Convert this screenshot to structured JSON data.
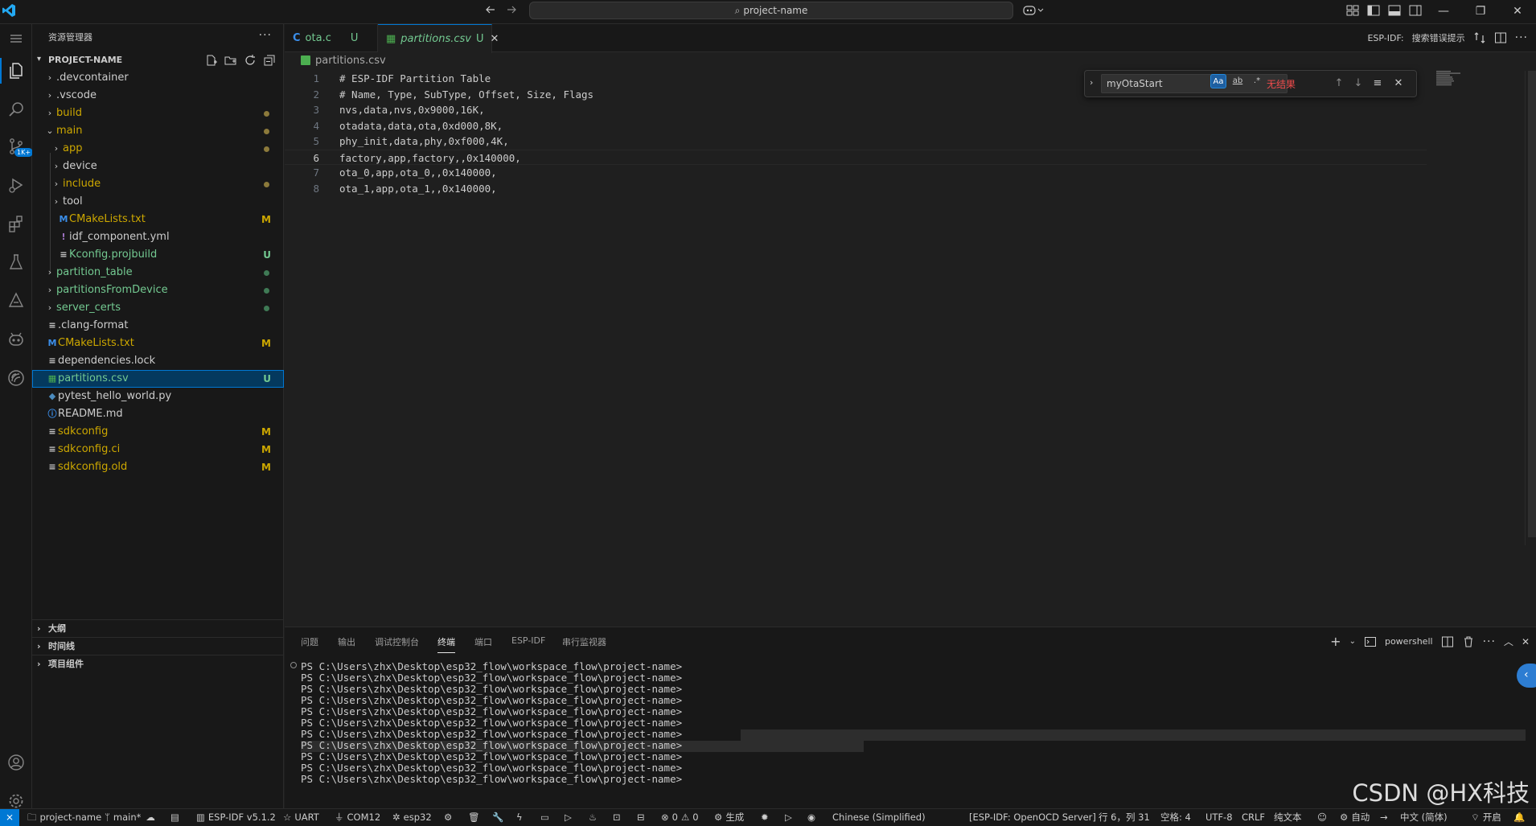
{
  "titlebar": {
    "search_text": "project-name",
    "back_icon": "arrow-left-icon",
    "forward_icon": "arrow-right-icon"
  },
  "sidebar": {
    "title": "资源管理器",
    "more": "···",
    "project": "PROJECT-NAME",
    "items": [
      {
        "label": "devcontainer",
        "display": ".devcontainer",
        "kind": "folder",
        "depth": 0,
        "color": "#cccccc",
        "deco": ""
      },
      {
        "label": "vscode",
        "display": ".vscode",
        "kind": "folder",
        "depth": 0,
        "color": "#cccccc",
        "deco": ""
      },
      {
        "label": "build",
        "display": "build",
        "kind": "folder",
        "depth": 0,
        "color": "#cca700",
        "deco": "dot",
        "deco_color": "#8c7a3b"
      },
      {
        "label": "main",
        "display": "main",
        "kind": "folder-open",
        "depth": 0,
        "color": "#cca700",
        "deco": "dot",
        "deco_color": "#8c7a3b"
      },
      {
        "label": "app",
        "display": "app",
        "kind": "folder",
        "depth": 1,
        "color": "#cca700",
        "deco": "dot",
        "deco_color": "#8c7a3b"
      },
      {
        "label": "device",
        "display": "device",
        "kind": "folder",
        "depth": 1,
        "color": "#cccccc",
        "deco": ""
      },
      {
        "label": "include",
        "display": "include",
        "kind": "folder",
        "depth": 1,
        "color": "#cca700",
        "deco": "dot",
        "deco_color": "#8c7a3b"
      },
      {
        "label": "tool",
        "display": "tool",
        "kind": "folder",
        "depth": 1,
        "color": "#cccccc",
        "deco": ""
      },
      {
        "label": "CMakeLists.txt",
        "display": "CMakeLists.txt",
        "kind": "file",
        "icon": "M",
        "icon_color": "#3b8eea",
        "depth": 1,
        "color": "#cca700",
        "deco": "M",
        "deco_color": "#cca700"
      },
      {
        "label": "idf_component.yml",
        "display": "idf_component.yml",
        "kind": "file",
        "icon": "!",
        "icon_color": "#a074c4",
        "depth": 1,
        "color": "#cccccc",
        "deco": ""
      },
      {
        "label": "Kconfig.projbuild",
        "display": "Kconfig.projbuild",
        "kind": "file",
        "icon": "≡",
        "icon_color": "#cccccc",
        "depth": 1,
        "color": "#73c991",
        "deco": "U",
        "deco_color": "#73c991"
      },
      {
        "label": "partition_table",
        "display": "partition_table",
        "kind": "folder",
        "depth": 0,
        "color": "#73c991",
        "deco": "dot",
        "deco_color": "#3f7a55"
      },
      {
        "label": "partitionsFromDevice",
        "display": "partitionsFromDevice",
        "kind": "folder",
        "depth": 0,
        "color": "#73c991",
        "deco": "dot",
        "deco_color": "#3f7a55"
      },
      {
        "label": "server_certs",
        "display": "server_certs",
        "kind": "folder",
        "depth": 0,
        "color": "#73c991",
        "deco": "dot",
        "deco_color": "#3f7a55"
      },
      {
        "label": "clang-format",
        "display": ".clang-format",
        "kind": "file",
        "icon": "≡",
        "icon_color": "#cccccc",
        "depth": 0,
        "color": "#cccccc",
        "deco": ""
      },
      {
        "label": "CMakeLists.txt",
        "display": "CMakeLists.txt",
        "kind": "file",
        "icon": "M",
        "icon_color": "#3b8eea",
        "depth": 0,
        "color": "#cca700",
        "deco": "M",
        "deco_color": "#cca700"
      },
      {
        "label": "dependencies.lock",
        "display": "dependencies.lock",
        "kind": "file",
        "icon": "≡",
        "icon_color": "#cccccc",
        "depth": 0,
        "color": "#cccccc",
        "deco": ""
      },
      {
        "label": "partitions.csv",
        "display": "partitions.csv",
        "kind": "file",
        "icon": "▦",
        "icon_color": "#4caf50",
        "depth": 0,
        "color": "#73c991",
        "deco": "U",
        "deco_color": "#73c991",
        "selected": true
      },
      {
        "label": "pytest_hello_world.py",
        "display": "pytest_hello_world.py",
        "kind": "file",
        "icon": "◆",
        "icon_color": "#4b8bbe",
        "depth": 0,
        "color": "#cccccc",
        "deco": ""
      },
      {
        "label": "README.md",
        "display": "README.md",
        "kind": "file",
        "icon": "ⓘ",
        "icon_color": "#3b8eea",
        "depth": 0,
        "color": "#cccccc",
        "deco": ""
      },
      {
        "label": "sdkconfig",
        "display": "sdkconfig",
        "kind": "file",
        "icon": "≡",
        "icon_color": "#cccccc",
        "depth": 0,
        "color": "#cca700",
        "deco": "M",
        "deco_color": "#cca700"
      },
      {
        "label": "sdkconfig.ci",
        "display": "sdkconfig.ci",
        "kind": "file",
        "icon": "≡",
        "icon_color": "#cccccc",
        "depth": 0,
        "color": "#cca700",
        "deco": "M",
        "deco_color": "#cca700"
      },
      {
        "label": "sdkconfig.old",
        "display": "sdkconfig.old",
        "kind": "file",
        "icon": "≡",
        "icon_color": "#cccccc",
        "depth": 0,
        "color": "#cca700",
        "deco": "M",
        "deco_color": "#cca700"
      }
    ],
    "outline": "大纲",
    "timeline": "时间线",
    "project_components": "项目组件",
    "scm_badge": "1K+"
  },
  "tabs": [
    {
      "icon": "C",
      "label": "ota.c",
      "status": "U",
      "active": false,
      "icon_color": "#3b8eea",
      "label_color": "#73c991"
    },
    {
      "icon": "▦",
      "label": "partitions.csv",
      "status": "U",
      "active": true,
      "icon_color": "#4caf50",
      "label_color": "#73c991",
      "close": "✕"
    }
  ],
  "tab_actions": {
    "espidf": "ESP-IDF:",
    "search_hint": "搜索错误提示"
  },
  "breadcrumb": "partitions.csv",
  "editor": {
    "lines": [
      "# ESP-IDF Partition Table",
      "# Name, Type, SubType, Offset, Size, Flags",
      "nvs,data,nvs,0x9000,16K,",
      "otadata,data,ota,0xd000,8K,",
      "phy_init,data,phy,0xf000,4K,",
      "factory,app,factory,,0x140000,",
      "ota_0,app,ota_0,,0x140000,",
      "ota_1,app,ota_1,,0x140000,"
    ],
    "current_line": 6
  },
  "find": {
    "value": "myOtaStart",
    "match_case": "Aa",
    "whole_word": "ab",
    "regex": ".*",
    "no_results": "无结果"
  },
  "panel": {
    "tabs": [
      "问题",
      "输出",
      "调试控制台",
      "终端",
      "端口",
      "ESP-IDF",
      "串行监视器"
    ],
    "active_tab": 3,
    "shell": "powershell",
    "terminal_lines": [
      "PS C:\\Users\\zhx\\Desktop\\esp32_flow\\workspace_flow\\project-name>",
      "PS C:\\Users\\zhx\\Desktop\\esp32_flow\\workspace_flow\\project-name>",
      "PS C:\\Users\\zhx\\Desktop\\esp32_flow\\workspace_flow\\project-name>",
      "PS C:\\Users\\zhx\\Desktop\\esp32_flow\\workspace_flow\\project-name>",
      "PS C:\\Users\\zhx\\Desktop\\esp32_flow\\workspace_flow\\project-name>",
      "PS C:\\Users\\zhx\\Desktop\\esp32_flow\\workspace_flow\\project-name>",
      "PS C:\\Users\\zhx\\Desktop\\esp32_flow\\workspace_flow\\project-name>",
      "PS C:\\Users\\zhx\\Desktop\\esp32_flow\\workspace_flow\\project-name>",
      "PS C:\\Users\\zhx\\Desktop\\esp32_flow\\workspace_flow\\project-name>",
      "PS C:\\Users\\zhx\\Desktop\\esp32_flow\\workspace_flow\\project-name>",
      "PS C:\\Users\\zhx\\Desktop\\esp32_flow\\workspace_flow\\project-name>"
    ],
    "watermark": "CSDN @HX科技"
  },
  "status": {
    "project": "project-name",
    "branch": "main*",
    "espidf_version": "ESP-IDF v5.1.2",
    "uart": "UART",
    "port": "COM12",
    "target": "esp32",
    "errors": "0",
    "warnings": "0",
    "build": "生成",
    "language_pack": "Chinese (Simplified)",
    "openocd": "[ESP-IDF: OpenOCD Server]",
    "position": "行 6，列 31",
    "spaces": "空格: 4",
    "encoding": "UTF-8",
    "eol": "CRLF",
    "language": "纯文本",
    "auto": "自动",
    "locale": "中文 (简体)",
    "on": "开启"
  },
  "colors": {
    "accent": "#0078d4",
    "modified": "#cca700",
    "untracked": "#73c991",
    "error": "#f14c4c"
  }
}
